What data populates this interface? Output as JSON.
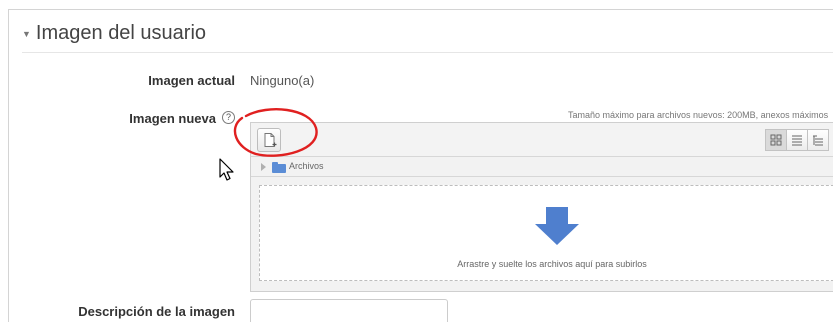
{
  "section": {
    "title": "Imagen del usuario"
  },
  "current_image": {
    "label": "Imagen actual",
    "value": "Ninguno(a)"
  },
  "new_image": {
    "label": "Imagen nueva",
    "help_icon": "?",
    "max_size_text": "Tamaño máximo para archivos nuevos: 200MB, anexos máximos",
    "path_label": "Archivos",
    "dropzone_text": "Arrastre y suelte los archivos aquí para subirlos"
  },
  "description": {
    "label": "Descripción de la imagen",
    "value": ""
  },
  "icons": {
    "collapse": "caret-down-icon",
    "add_file": "add-file-icon",
    "view_icons": "grid-icon",
    "view_list": "list-icon",
    "view_tree": "tree-icon",
    "folder": "folder-icon",
    "upload_arrow": "down-arrow-icon",
    "cursor": "mouse-pointer-icon"
  },
  "colors": {
    "folder": "#5b8dd6",
    "arrow": "#4f7fce",
    "annotation": "#e02020"
  }
}
